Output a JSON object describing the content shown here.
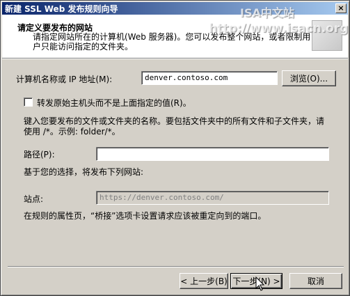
{
  "window": {
    "title": "新建 SSL Web 发布规则向导",
    "close_glyph": "×"
  },
  "watermark": {
    "line1": "ISA中文站",
    "line2": "http://www.isacn.org"
  },
  "header": {
    "title": "请定义要发布的网站",
    "description": "请指定网站所在的计算机(Web 服务器)。您可以发布整个网站，或者限制用户只能访问指定的文件夹。"
  },
  "form": {
    "computer_label": "计算机名称或 IP 地址(M):",
    "computer_value": "denver.contoso.com",
    "browse_label": "浏览(O)...",
    "forward_header_label": "转发原始主机头而不是上面指定的值(R)。",
    "forward_header_checked": false,
    "instruction": "键入您要发布的文件或文件夹的名称。要包括文件夹中的所有文件和子文件夹，请使用 /*。示例: folder/*。",
    "path_label": "路径(P):",
    "path_value": "",
    "publish_note": "基于您的选择，将发布下列网站:",
    "site_label": "站点:",
    "site_value": "https://denver.contoso.com/",
    "bridge_note": "在规则的属性页，“桥接”选项卡设置请求应该被重定向到的端口。"
  },
  "buttons": {
    "back": "< 上一步(B)",
    "next": "下一步(N) >",
    "cancel": "取消"
  }
}
